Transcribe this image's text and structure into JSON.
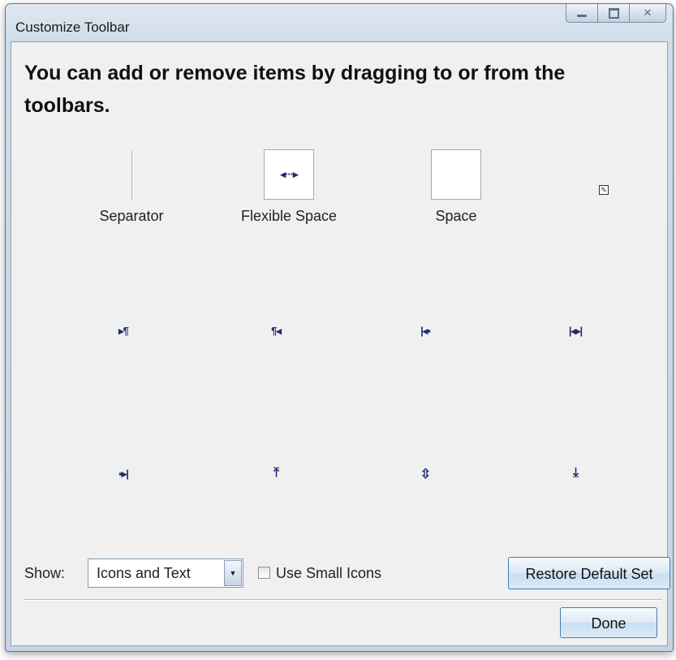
{
  "window": {
    "title": "Customize Toolbar",
    "controls": {
      "minimize": "minimize-icon",
      "maximize": "maximize-icon",
      "close": "close-icon",
      "close_glyph": "✕"
    }
  },
  "heading": "You can add or remove items by dragging to or from the toolbars.",
  "items": {
    "separator": {
      "label": "Separator"
    },
    "flexible_space": {
      "label": "Flexible Space",
      "glyph": "◂···▸"
    },
    "space": {
      "label": "Space"
    },
    "edit": {
      "icon": "edit-icon",
      "glyph": "✎"
    },
    "row2": [
      {
        "icon": "ltr-paragraph-icon",
        "glyph": "▸¶"
      },
      {
        "icon": "rtl-paragraph-icon",
        "glyph": "¶◂"
      },
      {
        "icon": "indent-left-icon",
        "glyph": "|◂▪"
      },
      {
        "icon": "justify-width-icon",
        "glyph": "|◂▸|"
      }
    ],
    "row3": [
      {
        "icon": "indent-right-icon",
        "glyph": "▪▸|"
      },
      {
        "icon": "align-top-icon",
        "glyph": "⤒"
      },
      {
        "icon": "align-middle-icon",
        "glyph": "⇳"
      },
      {
        "icon": "align-bottom-icon",
        "glyph": "⤓"
      }
    ]
  },
  "footer": {
    "show_label": "Show:",
    "show_select": {
      "value": "Icons and Text",
      "arrow": "▼"
    },
    "small_icons": {
      "label": "Use Small Icons",
      "checked": false
    },
    "restore_button": "Restore Default Set",
    "done_button": "Done"
  }
}
